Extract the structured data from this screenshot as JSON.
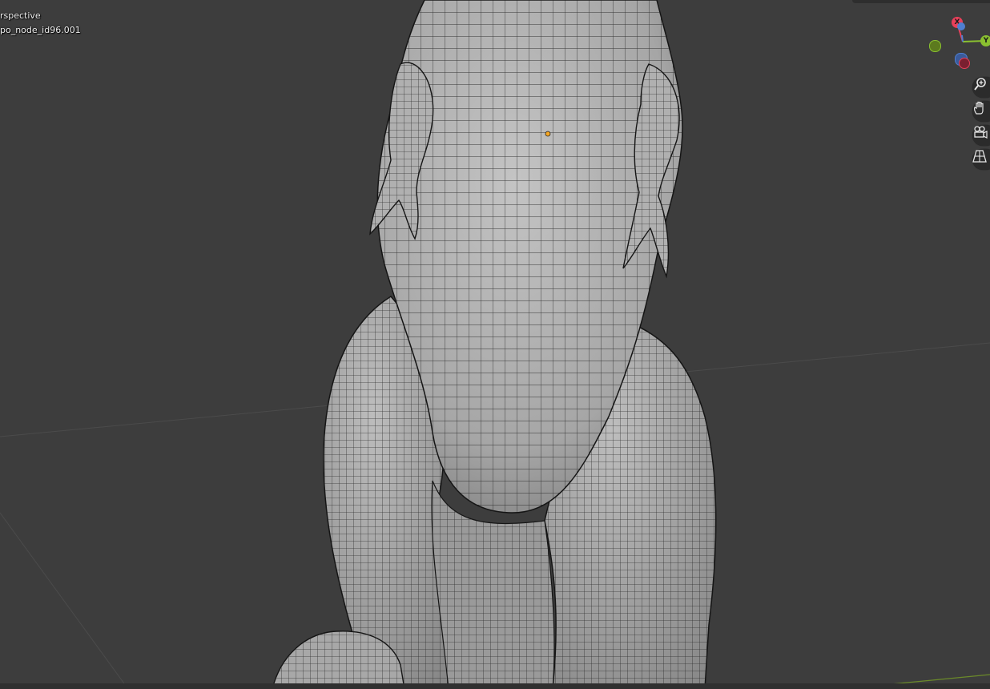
{
  "viewport": {
    "view_label": "rspective",
    "object_label": "po_node_id96.001"
  },
  "gizmo": {
    "x_label": "X",
    "y_label": "Y",
    "colors": {
      "x": "#e8405a",
      "y": "#8ac030",
      "z": "#4f7fd0",
      "neg_y": "#5c7a1e"
    }
  },
  "nav_buttons": [
    {
      "name": "zoom-icon"
    },
    {
      "name": "pan-hand-icon"
    },
    {
      "name": "camera-view-icon"
    },
    {
      "name": "ortho-grid-icon"
    }
  ],
  "colors": {
    "background": "#3d3d3d",
    "mesh": "#aeaeae",
    "wireframe": "#1e1e1e",
    "origin_dot": "#f5a623"
  }
}
